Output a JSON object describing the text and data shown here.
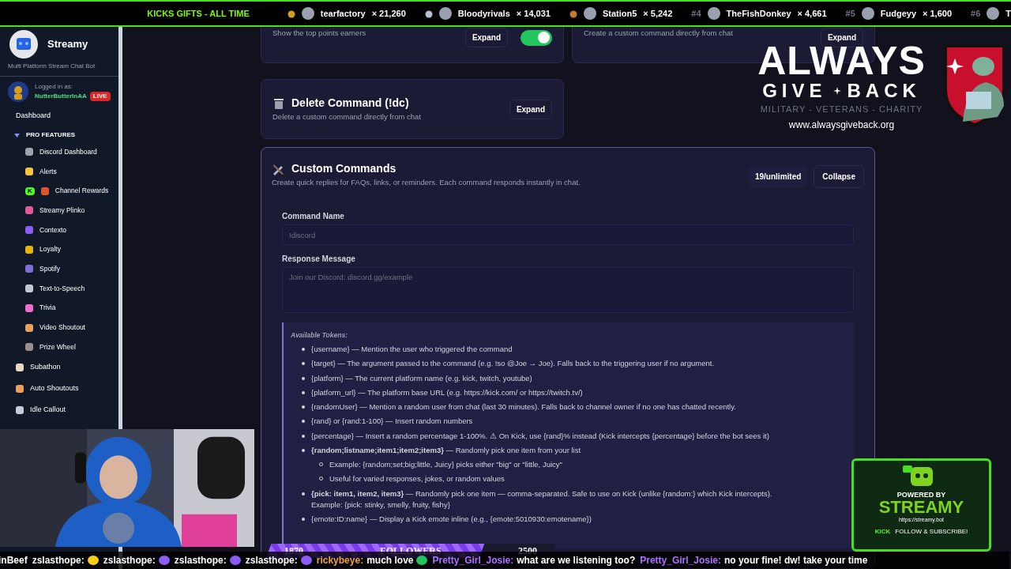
{
  "ticker": {
    "title": "KICKS GIFTS - ALL TIME",
    "entries": [
      {
        "color": "#d4a017",
        "user": "tearfactory",
        "count": "× 21,260"
      },
      {
        "color": "#b8c0cc",
        "user": "Bloodyrivals",
        "count": "× 14,031"
      },
      {
        "color": "#c07a2c",
        "user": "Station5",
        "count": "× 5,242"
      },
      {
        "rank": "#4",
        "user": "TheFishDonkey",
        "count": "× 4,661"
      },
      {
        "rank": "#5",
        "user": "Fudgeyy",
        "count": "× 1,600"
      },
      {
        "rank": "#6",
        "user": "T"
      }
    ]
  },
  "sidebar": {
    "brand": "Streamy",
    "tagline": "Multi Platform Stream Chat Bot",
    "login_label": "Logged in as:",
    "username": "NutterButterInAA",
    "live": "LIVE",
    "items": [
      {
        "kind": "link",
        "label": "Dashboard"
      },
      {
        "kind": "section",
        "label": "PRO FEATURES",
        "expanded": true,
        "children": [
          {
            "label": "Discord Dashboard",
            "color": "#9ca3af"
          },
          {
            "label": "Alerts",
            "color": "#f5c542"
          },
          {
            "label": "Channel Rewards",
            "color": "#e0532f",
            "badge": "K"
          },
          {
            "label": "Streamy Plinko",
            "color": "#e05a9a"
          },
          {
            "label": "Contexto",
            "color": "#8b5cf6"
          },
          {
            "label": "Loyalty",
            "color": "#eab308"
          },
          {
            "label": "Spotify",
            "color": "#7c6fd6"
          },
          {
            "label": "Text-to-Speech",
            "color": "#c4c8d4"
          },
          {
            "label": "Trivia",
            "color": "#ec6fcf"
          },
          {
            "label": "Video Shoutout",
            "color": "#e8a060"
          },
          {
            "label": "Prize Wheel",
            "color": "#9a8f8a"
          }
        ]
      },
      {
        "kind": "link",
        "label": "Subathon",
        "color": "#e8dcc0"
      },
      {
        "kind": "link",
        "label": "Auto Shoutouts",
        "color": "#e8a060"
      },
      {
        "kind": "link",
        "label": "Idle Callout",
        "color": "#c8ccd6"
      }
    ]
  },
  "cards": [
    {
      "subtitle": "Show the top points earners",
      "button": "Expand",
      "toggle": {
        "on": true
      }
    },
    {
      "subtitle": "Create a custom command directly from chat",
      "button": "Expand"
    },
    {
      "title": "Delete Command (!dc)",
      "subtitle": "Delete a custom command directly from chat",
      "button": "Expand"
    }
  ],
  "custom_commands": {
    "title": "Custom Commands",
    "subtitle": "Create quick replies for FAQs, links, or reminders. Each command responds instantly in chat.",
    "count": "19/unlimited",
    "button": "Collapse",
    "fields": [
      {
        "kind": "input",
        "label": "Command Name",
        "placeholder": "!discord"
      },
      {
        "kind": "textarea",
        "label": "Response Message",
        "placeholder": "Join our Discord: discord.gg/example"
      }
    ],
    "tokens": {
      "heading": "Available Tokens:",
      "items": [
        {
          "text": "{username} — Mention the user who triggered the command"
        },
        {
          "text": "{target} — The argument passed to the command (e.g. !so @Joe → Joe). Falls back to the triggering user if no argument."
        },
        {
          "text": "{platform} — The current platform name (e.g. kick, twitch, youtube)"
        },
        {
          "text": "{platform_url} — The platform base URL (e.g. https://kick.com/ or https://twitch.tv/)"
        },
        {
          "text": "{randomUser} — Mention a random user from chat (last 30 minutes). Falls back to channel owner if no one has chatted recently."
        },
        {
          "text": "{rand} or {rand:1-100} — Insert random numbers"
        },
        {
          "text": "{percentage} — Insert a random percentage 1-100%. ⚠ On Kick, use {rand}% instead (Kick intercepts {percentage} before the bot sees it)"
        },
        {
          "text": "**{random;listname;item1;item2;item3}** — Randomly pick one item from your list",
          "children": [
            "Example: {random;set;big;little, Juicy} picks either \"big\" or \"little, Juicy\"",
            "Useful for varied responses, jokes, or random values"
          ]
        },
        {
          "text": "**{pick: item1, item2, item3}** — Randomly pick one item — comma-separated. Safe to use on Kick (unlike {random:} which Kick intercepts).",
          "note": "Example: {pick: stinky, smelly, fruity, fishy}"
        },
        {
          "text": "{emote:ID:name} — Display a Kick emote inline (e.g., {emote:5010930:emotename})"
        }
      ]
    }
  },
  "charity": {
    "word_1": "ALWAYS",
    "word_2": "GIVE",
    "word_3": "BACK",
    "tagline": "MILITARY - VETERANS - CHARITY",
    "url": "www.alwaysgiveback.org"
  },
  "followers_goal": {
    "current": "1870",
    "label": "FOLLOWERS",
    "target": "2500",
    "level": 0.75
  },
  "streamy_badge": {
    "line_1": "POWERED BY",
    "line_2": "STREAMY",
    "url": "https://streamy.bot",
    "platform": "KICK",
    "cta": "FOLLOW & SUBSCRIBE!"
  },
  "chat": [
    {
      "message": "inBeef"
    },
    {
      "user": "zslasthope:",
      "color": "#ffffff",
      "emote": true
    },
    {
      "user": "zslasthope:",
      "color": "#ffffff",
      "emote": true
    },
    {
      "user": "zslasthope:",
      "color": "#ffffff",
      "emote": true
    },
    {
      "user": "zslasthope:",
      "color": "#ffffff",
      "emote": true
    },
    {
      "user": "rickybeye:",
      "color": "#f0a040",
      "message": "much love",
      "emote": true
    },
    {
      "user": "Pretty_Girl_Josie:",
      "color": "#b070ff",
      "message": "what are we listening too?"
    },
    {
      "user": "Pretty_Girl_Josie:",
      "color": "#b070ff",
      "message": "no your fine! dw! take your time"
    }
  ]
}
